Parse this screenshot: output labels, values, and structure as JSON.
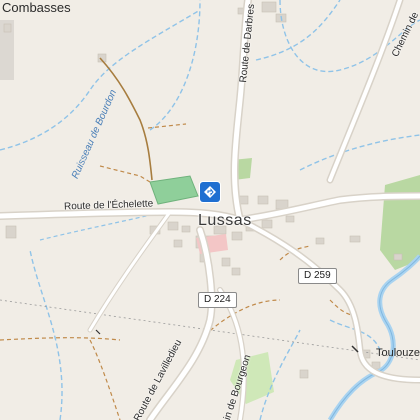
{
  "map": {
    "place_labels": {
      "combasses": "Combasses",
      "lussas": "Lussas",
      "toulouze": "Toulouze"
    },
    "road_labels": {
      "route_darbres": "Route de Darbres",
      "route_echelette": "Route de l'Échelette",
      "route_lavilledieu": "Route de Lavilledieu",
      "chemin_bourgeon": "in de Bourgeon",
      "chemin_top": "Chemin de"
    },
    "water_labels": {
      "ruisseau_bourdon": "Ruisseau de Bourdon"
    },
    "road_shields": {
      "d224": "D 224",
      "d259": "D 259"
    },
    "icons": {
      "poi": "tourism-diamond-icon"
    },
    "colors": {
      "land": "#f1ede6",
      "road": "#ffffff",
      "road_casing": "#d8d2c8",
      "stream": "#8fc3e8",
      "river": "#a9d3f0",
      "path": "#a77d3f",
      "track": "#c08a4a",
      "forest": "#b9d8a2",
      "sports_field": "#8fcf9a",
      "building": "#d9d4cc",
      "poi_blue": "#1f6fd1"
    }
  }
}
